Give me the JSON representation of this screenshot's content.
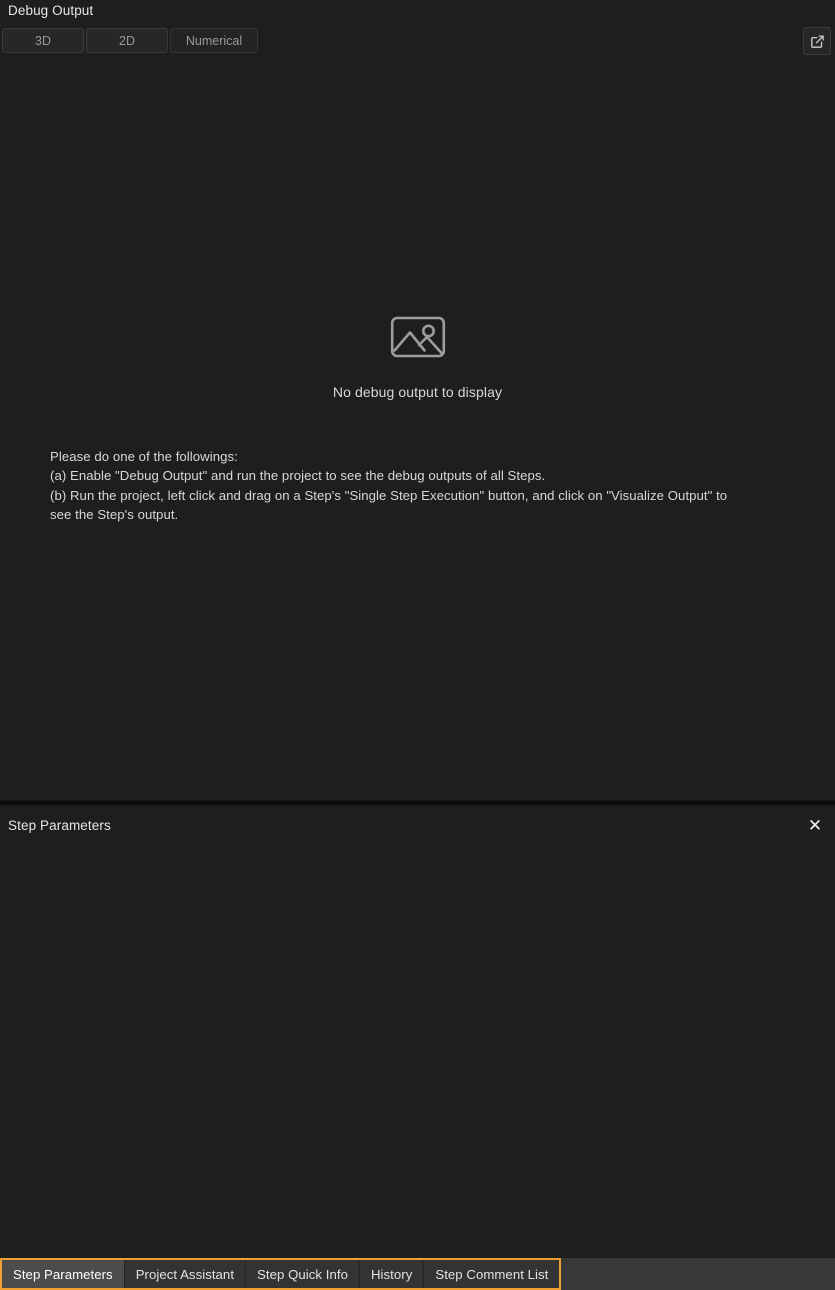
{
  "debug_panel": {
    "title": "Debug Output",
    "mode_buttons": [
      {
        "label": "3D",
        "name": "mode-3d"
      },
      {
        "label": "2D",
        "name": "mode-2d"
      },
      {
        "label": "Numerical",
        "name": "mode-numerical"
      }
    ],
    "popout_icon": "external-link-icon",
    "empty_state": {
      "icon": "image-placeholder-icon",
      "message": "No debug output to display"
    },
    "hint": {
      "line1": "Please do one of the followings:",
      "line2": "(a) Enable \"Debug Output\" and run the project to see the debug outputs of all Steps.",
      "line3": "(b) Run the project, left click and drag on a Step's \"Single Step Execution\" button, and click on \"Visualize Output\" to see the Step's output."
    }
  },
  "params_panel": {
    "title": "Step Parameters",
    "close_icon": "close-icon",
    "close_label": "✕"
  },
  "tabbar": {
    "tabs": [
      {
        "label": "Step Parameters",
        "active": true
      },
      {
        "label": "Project Assistant",
        "active": false
      },
      {
        "label": "Step Quick Info",
        "active": false
      },
      {
        "label": "History",
        "active": false
      },
      {
        "label": "Step Comment List",
        "active": false
      }
    ]
  },
  "colors": {
    "background": "#1e1e1e",
    "accent": "#f0a030",
    "active_tab": "#4c4c4c",
    "tab": "#333333",
    "tabbar": "#383838",
    "text": "#e6e6e6",
    "muted_text": "#9a9a9a"
  }
}
